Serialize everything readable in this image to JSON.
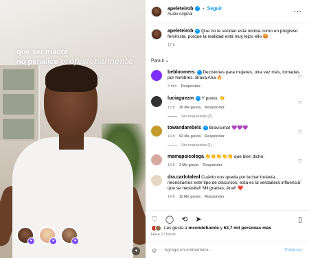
{
  "media": {
    "overlay_line1": "que ser madre",
    "overlay_line2_prefix": "no penalice",
    "overlay_line2_italic": "profesionalmente"
  },
  "header": {
    "username": "apeleteirob",
    "follow_label": "Seguir",
    "audio_label": "Audio original",
    "more_icon": "more-horizontal-icon"
  },
  "caption": {
    "username": "apeleteirob",
    "text": "Que no te vendan esta noticia como un progreso feminista, porque la realidad está muy lejos ello 😡",
    "time": "17 h"
  },
  "for_you_label": "Para ti ⌄",
  "comments": [
    {
      "username": "bebloomers",
      "verified": true,
      "text": "Decisiones para mujeres, otra vez más, tomadas por hombres. Brava Ana 🔥",
      "time": "3 min",
      "reply": "Responder",
      "likes": "",
      "view_replies": "",
      "avatar_color": "#7b2ff7"
    },
    {
      "username": "luciaguezm",
      "verified": true,
      "text": "Y punto. 👏",
      "time": "15 h",
      "likes": "10 Me gusta",
      "reply": "Responder",
      "view_replies": "Ver respuestas (2)",
      "avatar_color": "#333333"
    },
    {
      "username": "towandarebels",
      "verified": true,
      "text": "Bravísima! 💜💜💜",
      "time": "14 h",
      "likes": "92 Me gusta",
      "reply": "Responder",
      "view_replies": "Ver respuestas (1)",
      "avatar_color": "#c49a2a"
    },
    {
      "username": "mamapsicologa",
      "verified": false,
      "text": "👏👏👏👏👏 que bien dicho.",
      "time": "13 h",
      "likes": "3 Me gusta",
      "reply": "Responder",
      "view_replies": "",
      "avatar_color": "#d8a8a0"
    },
    {
      "username": "dra.carlotaleal",
      "verified": false,
      "text": "Cuánto nos queda por luchar todavía... necesitamos este tipo de discursos, esta es la verdadera influencia que se necesita!! Mil gracias, Ana!! ❤️",
      "time": "14 h",
      "likes": "11 Me gusta",
      "reply": "Responder",
      "view_replies": "",
      "avatar_color": "#e6d6c4"
    }
  ],
  "actions": {
    "like_icon": "heart-icon",
    "comment_icon": "comment-icon",
    "share_icon": "share-icon",
    "repost_icon": "repost-icon",
    "save_icon": "bookmark-icon"
  },
  "likes": {
    "prefix": "Les gusta a",
    "user": "mcondefuente",
    "middle": "y",
    "count": "63,7 mil personas más"
  },
  "posted_ago": "Hace 17 horas",
  "add_comment": {
    "placeholder": "Agrega un comentario...",
    "post_label": "Publicar"
  }
}
